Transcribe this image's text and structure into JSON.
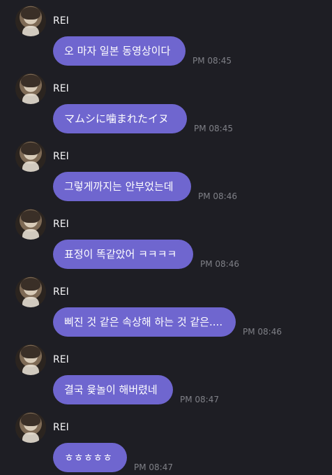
{
  "messages": [
    {
      "sender": "REI",
      "text": "오 마자 일본 동영상이다",
      "time": "PM 08:45"
    },
    {
      "sender": "REI",
      "text": "マムシに噛まれたイヌ",
      "time": "PM 08:45"
    },
    {
      "sender": "REI",
      "text": "그렇게까지는 안부었는데",
      "time": "PM 08:46"
    },
    {
      "sender": "REI",
      "text": "표정이 똑같았어 ㅋㅋㅋㅋ",
      "time": "PM 08:46"
    },
    {
      "sender": "REI",
      "text": "삐진 것 같은 속상해 하는 것 같은....",
      "time": "PM 08:46"
    },
    {
      "sender": "REI",
      "text": "결국 윷놀이 해버렸네",
      "time": "PM 08:47"
    },
    {
      "sender": "REI",
      "text": "ㅎㅎㅎㅎㅎ",
      "time": "PM 08:47"
    }
  ]
}
